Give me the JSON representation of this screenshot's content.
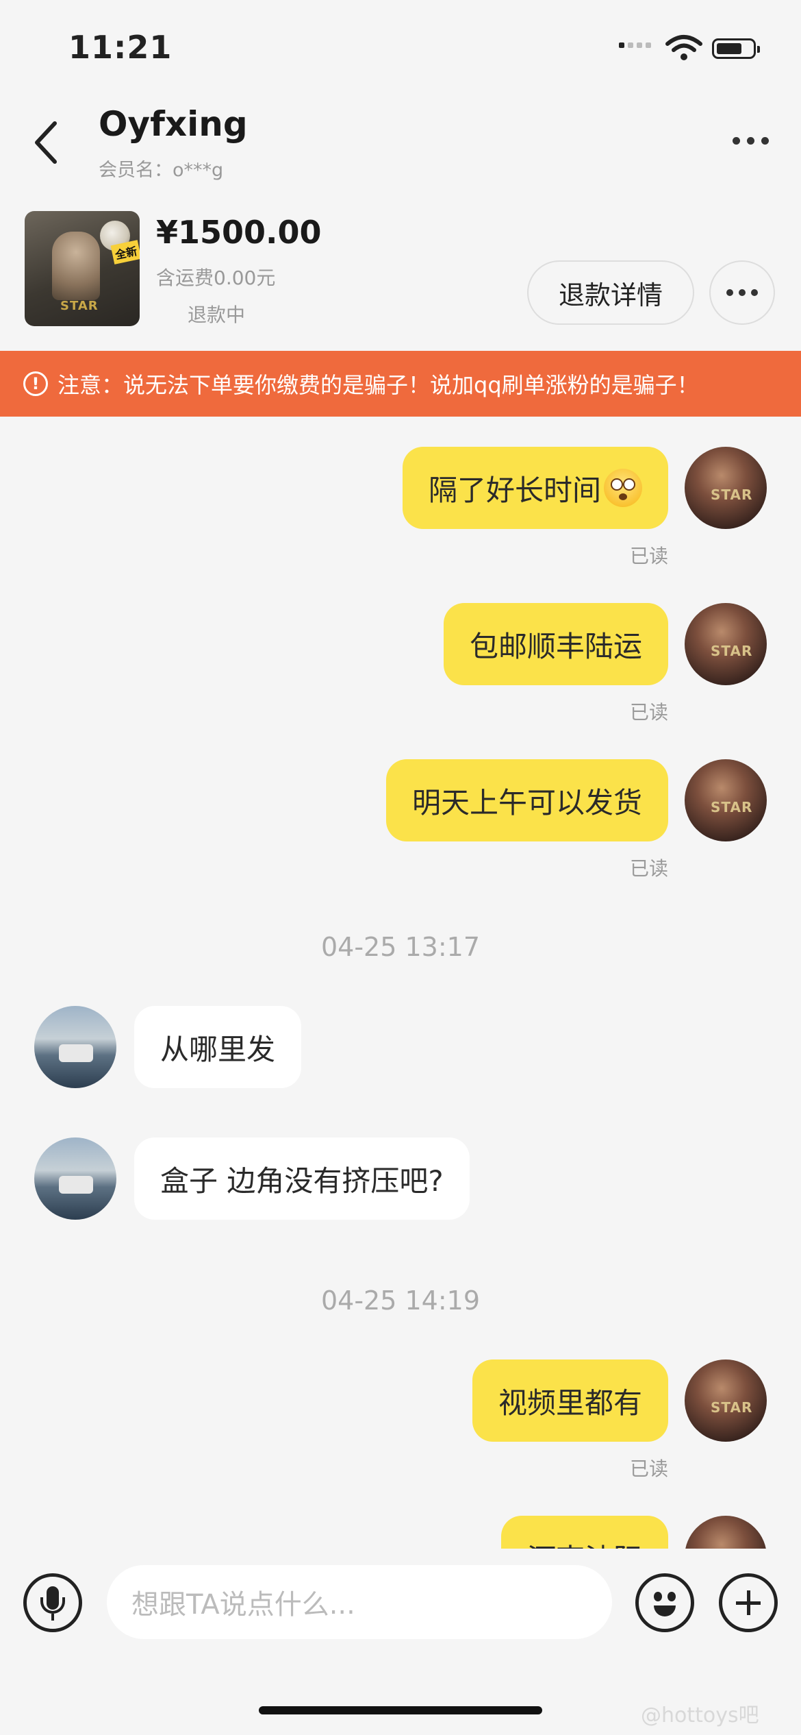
{
  "status_bar": {
    "time": "11:21"
  },
  "header": {
    "title": "Oyfxing",
    "subtitle": "会员名：o***g"
  },
  "product": {
    "thumb_tag": "全新",
    "thumb_logo": "STAR",
    "price": "¥1500.00",
    "shipping": "含运费0.00元",
    "status": "退款中",
    "refund_button": "退款详情"
  },
  "warning": {
    "icon": "!",
    "text": "注意：说无法下单要你缴费的是骗子！说加qq刷单涨粉的是骗子！"
  },
  "messages": [
    {
      "from": "me",
      "text": "隔了好长时间",
      "emoji": "flushed-face",
      "read": "已读"
    },
    {
      "from": "me",
      "text": "包邮顺丰陆运",
      "read": "已读"
    },
    {
      "from": "me",
      "text": "明天上午可以发货",
      "read": "已读"
    },
    {
      "timestamp": "04-25 13:17"
    },
    {
      "from": "other",
      "text": "从哪里发"
    },
    {
      "from": "other",
      "text": "盒子 边角没有挤压吧?"
    },
    {
      "timestamp": "04-25 14:19"
    },
    {
      "from": "me",
      "text": "视频里都有",
      "read": "已读"
    },
    {
      "from": "me",
      "text": "河南油阳"
    }
  ],
  "avatar_text": "STAR",
  "input": {
    "placeholder": "想跟TA说点什么..."
  },
  "watermark": "@hottoys吧",
  "colors": {
    "accent_yellow": "#fbe24a",
    "warning_orange": "#ef6a3d"
  }
}
